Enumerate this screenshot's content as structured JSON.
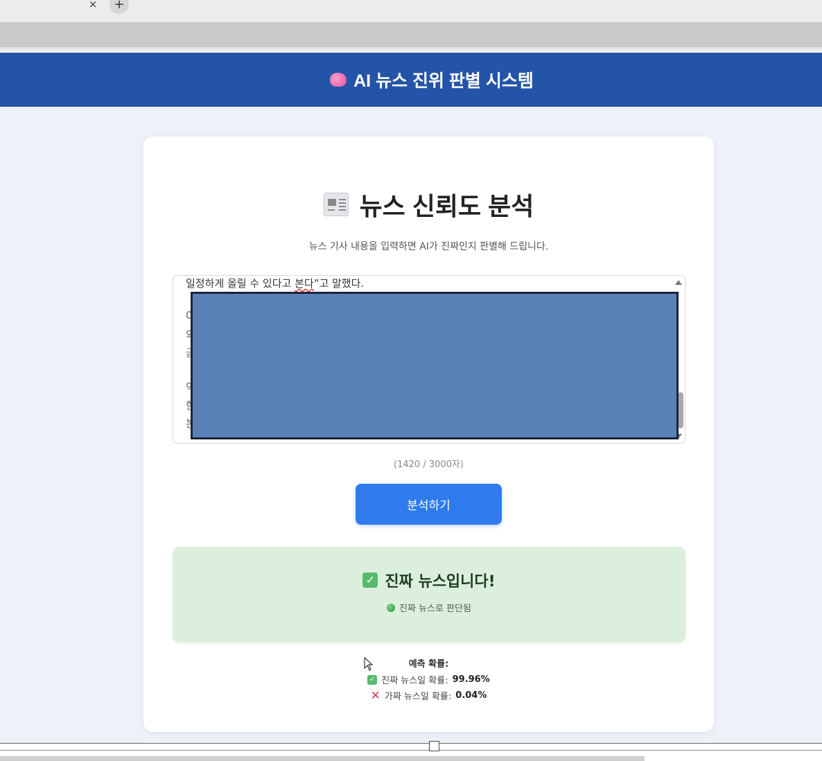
{
  "browser": {
    "tab_close": "×",
    "new_tab": "+"
  },
  "header": {
    "title": "AI 뉴스 진위 판별 시스템",
    "icon": "brain-icon",
    "color": "#2454a7"
  },
  "card": {
    "title": "뉴스 신뢰도 분석",
    "title_icon": "newspaper-icon",
    "subtitle": "뉴스 기사 내용을 입력하면 AI가 진짜인지 판별해 드립니다."
  },
  "textarea": {
    "visible_line_before": "일정하게 올릴 수 있다고 ",
    "visible_line_underlined": "본다",
    "visible_line_after": "”고 말했다.",
    "line_stubs": [
      "0",
      "와",
      "금",
      "약",
      "한",
      "본"
    ],
    "redacted": true
  },
  "char_count": "(1420 / 3000자)",
  "analyze_button": {
    "label": "분석하기",
    "color": "#2f7bee"
  },
  "result": {
    "title": "진짜 뉴스입니다!",
    "title_icon": "check-icon",
    "subtitle": "진짜 뉴스로 판단됨",
    "subtitle_icon": "green-dot-icon",
    "background": "#dcefdc"
  },
  "probabilities": {
    "heading": "예측 확률:",
    "real_label": "진짜 뉴스일 확률:",
    "real_value": "99.96%",
    "fake_label": "가짜 뉴스일 확률:",
    "fake_value": "0.04%"
  }
}
